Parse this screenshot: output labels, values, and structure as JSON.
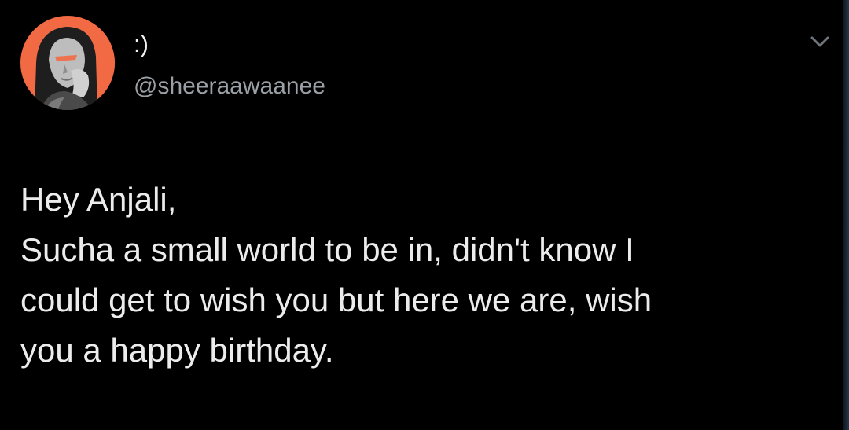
{
  "tweet": {
    "author": {
      "display_name": ":)",
      "handle": "@sheeraawaanee",
      "avatar_icon": "profile-photo-avatar",
      "avatar_background": "#f26a44"
    },
    "menu_icon": "chevron-down-icon",
    "text_lines": [
      "Hey Anjali,",
      "Sucha a small world to be in, didn't know I",
      "could get to wish you but here we are, wish",
      "you a happy birthday."
    ]
  },
  "colors": {
    "background": "#000000",
    "text_primary": "#ececec",
    "text_secondary": "#9aa0a6",
    "accent_orange": "#f26a44"
  }
}
